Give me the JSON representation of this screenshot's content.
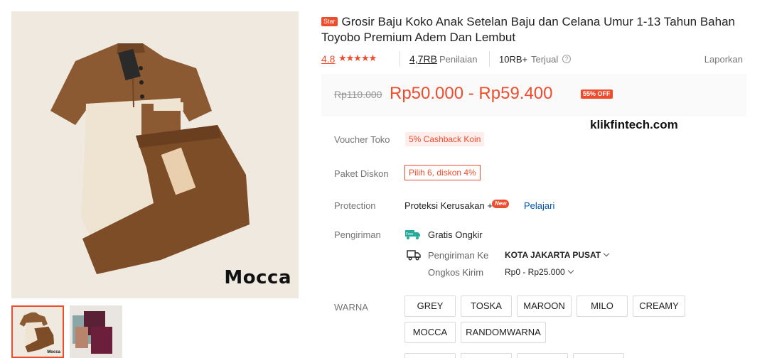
{
  "product": {
    "image_caption": "Mocca",
    "thumb_caption": "Mocca",
    "star_badge": "Star",
    "title": "Grosir Baju Koko Anak Setelan Baju dan Celana Umur 1-13 Tahun Bahan Toyobo Premium Adem Dan Lembut"
  },
  "rating": {
    "value": "4.8",
    "stars": "★★★★★",
    "reviews_count": "4,7RB",
    "reviews_label": "Penilaian",
    "sold_count": "10RB+",
    "sold_label": "Terjual",
    "help_icon": "?",
    "report_label": "Laporkan"
  },
  "price": {
    "original": "Rp110.000",
    "range": "Rp50.000 - Rp59.400",
    "discount": "55% OFF"
  },
  "watermark": "klikfintech.com",
  "details": {
    "voucher_label": "Voucher Toko",
    "voucher_value": "5% Cashback Koin",
    "paket_label": "Paket Diskon",
    "paket_value": "Pilih 6, diskon 4%",
    "protection_label": "Protection",
    "protection_value": "Proteksi Kerusakan +",
    "new_badge": "New",
    "learn_link": "Pelajari",
    "shipping_label": "Pengiriman",
    "free_badge": "Free",
    "free_shipping": "Gratis Ongkir",
    "ship_to_label": "Pengiriman Ke",
    "ship_to_value": "KOTA JAKARTA PUSAT",
    "cost_label": "Ongkos Kirim",
    "cost_value": "Rp0 - Rp25.000"
  },
  "variants": {
    "label": "WARNA",
    "options": [
      "GREY",
      "TOSKA",
      "MAROON",
      "MILO",
      "CREAMY",
      "MOCCA",
      "RANDOMWARNA"
    ]
  },
  "colors": {
    "accent": "#ee4d2d",
    "link": "#0055aa",
    "shirt_brown": "#8b5a32",
    "shirt_cream": "#efe3d1"
  }
}
